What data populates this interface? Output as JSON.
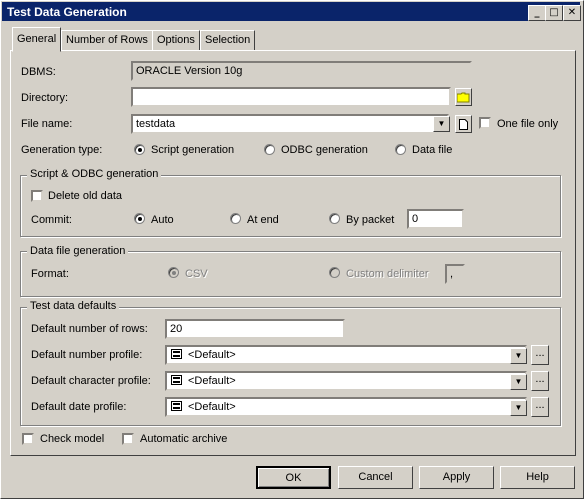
{
  "window": {
    "title": "Test Data Generation"
  },
  "title_buttons": {
    "minimize": "_",
    "maximize": "□",
    "close": "✕"
  },
  "tabs": [
    {
      "label": "General"
    },
    {
      "label": "Number of Rows"
    },
    {
      "label": "Options"
    },
    {
      "label": "Selection"
    }
  ],
  "general": {
    "dbms_label": "DBMS:",
    "dbms_value": "ORACLE Version 10g",
    "directory_label": "Directory:",
    "directory_value": "",
    "filename_label": "File name:",
    "filename_value": "testdata",
    "one_file_only_label": "One file only",
    "generation_type_label": "Generation type:",
    "generation_types": [
      "Script generation",
      "ODBC generation",
      "Data file"
    ],
    "generation_type_selected": "Script generation"
  },
  "script_odbc": {
    "group_label": "Script & ODBC generation",
    "delete_old_data_label": "Delete old data",
    "commit_label": "Commit:",
    "commit_options": [
      "Auto",
      "At end",
      "By packet"
    ],
    "commit_selected": "Auto",
    "packet_value": "0"
  },
  "data_file": {
    "group_label": "Data file generation",
    "format_label": "Format:",
    "format_options": [
      "CSV",
      "Custom delimiter"
    ],
    "format_selected": "CSV",
    "delimiter_value": ","
  },
  "defaults": {
    "group_label": "Test data defaults",
    "rows_label": "Default number of rows:",
    "rows_value": "20",
    "number_profile_label": "Default number profile:",
    "number_profile_value": "<Default>",
    "character_profile_label": "Default character profile:",
    "character_profile_value": "<Default>",
    "date_profile_label": "Default date profile:",
    "date_profile_value": "<Default>",
    "browse_label": "..."
  },
  "footer": {
    "check_model_label": "Check model",
    "automatic_archive_label": "Automatic archive"
  },
  "buttons": {
    "ok": "OK",
    "cancel": "Cancel",
    "apply": "Apply",
    "help": "Help"
  },
  "icons": {
    "folder": "folder-icon",
    "new_file": "new-file-icon",
    "profile": "profile-icon",
    "dropdown": "chevron-down-icon"
  }
}
